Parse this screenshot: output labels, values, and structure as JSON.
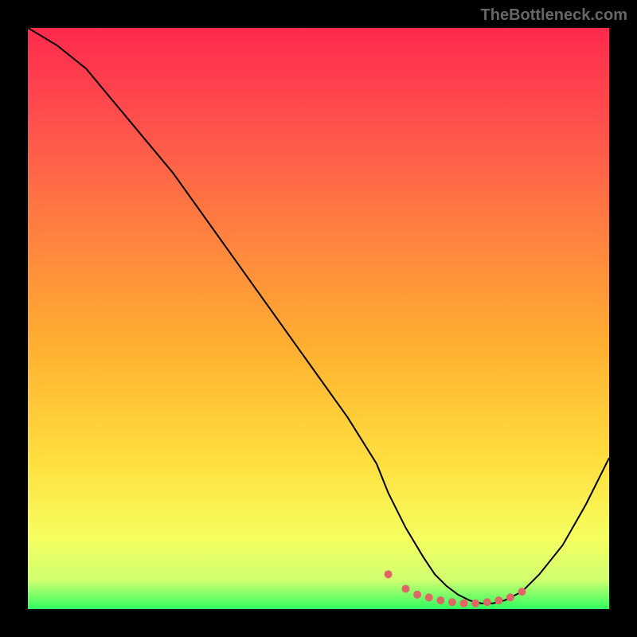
{
  "attribution": "TheBottleneck.com",
  "chart_data": {
    "type": "line",
    "title": "",
    "xlabel": "",
    "ylabel": "",
    "xlim": [
      0,
      100
    ],
    "ylim": [
      0,
      100
    ],
    "series": [
      {
        "name": "curve",
        "color": "#000000",
        "x": [
          0,
          5,
          10,
          15,
          20,
          25,
          30,
          35,
          40,
          45,
          50,
          55,
          60,
          62,
          65,
          68,
          70,
          72,
          74,
          76,
          78,
          80,
          82,
          85,
          88,
          92,
          96,
          100
        ],
        "values": [
          100,
          97,
          93,
          87,
          81,
          75,
          68,
          61,
          54,
          47,
          40,
          33,
          25,
          20,
          14,
          9,
          6,
          4,
          2.5,
          1.5,
          1,
          1,
          1.5,
          3,
          6,
          11,
          18,
          26
        ]
      }
    ],
    "markers": {
      "color": "#e06666",
      "radius": 5,
      "x": [
        62,
        65,
        67,
        69,
        71,
        73,
        75,
        77,
        79,
        81,
        83,
        85
      ],
      "values": [
        6,
        3.5,
        2.5,
        2,
        1.5,
        1.2,
        1,
        1,
        1.2,
        1.5,
        2,
        3
      ]
    },
    "gradient_stops": [
      {
        "offset": 0.0,
        "color": "#ff2a4d"
      },
      {
        "offset": 0.15,
        "color": "#ff4d4d"
      },
      {
        "offset": 0.35,
        "color": "#ff8040"
      },
      {
        "offset": 0.55,
        "color": "#ffb030"
      },
      {
        "offset": 0.75,
        "color": "#ffe040"
      },
      {
        "offset": 0.88,
        "color": "#f5ff60"
      },
      {
        "offset": 0.95,
        "color": "#d0ff70"
      },
      {
        "offset": 1.0,
        "color": "#30ff60"
      }
    ]
  }
}
